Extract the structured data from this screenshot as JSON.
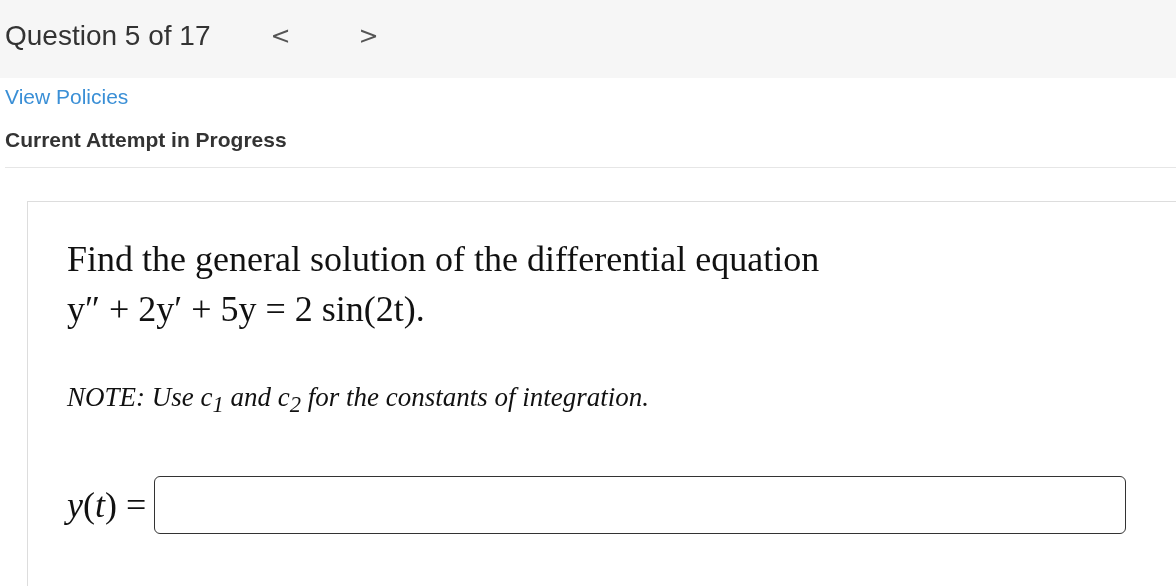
{
  "header": {
    "title": "Question 5 of 17",
    "nav_buttons": [
      "<",
      ">"
    ]
  },
  "policies_link": "View Policies",
  "status": "Current Attempt in Progress",
  "question": {
    "prompt": "Find the general solution of the differential equation",
    "equation": "y″ + 2y′ + 5y = 2 sin(2t).",
    "note": "NOTE: Use c$_{1}$ and c$_{2}$ for the constants of integration."
  },
  "answer": {
    "label": "*y*(*t*) ="
  }
}
